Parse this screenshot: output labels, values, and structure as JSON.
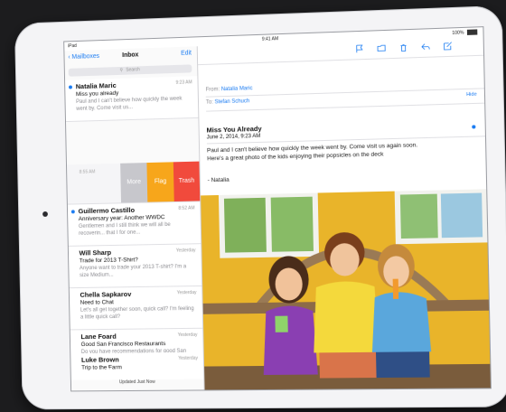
{
  "status": {
    "device": "iPad",
    "time": "9:41 AM",
    "battery": "100%"
  },
  "mailbox_nav": {
    "back_label": "Mailboxes",
    "title": "Inbox",
    "edit_label": "Edit"
  },
  "search": {
    "placeholder": "Search"
  },
  "messages": [
    {
      "sender": "Natalia Maric",
      "time": "9:23 AM",
      "subject": "Miss you already",
      "preview": "Paul and I can't believe how quickly the week went by. Come visit us...",
      "unread": true
    },
    {
      "sender": "Guillermo Castillo",
      "time": "8:52 AM",
      "subject": "Anniversary year: Another WWDC",
      "preview": "Gentlemen and I still think we will all be recoverin... that I for one...",
      "unread": true
    },
    {
      "sender": "Will Sharp",
      "time": "Yesterday",
      "subject": "Trade for 2013 T-Shirt?",
      "preview": "Anyone want to trade your 2013 T-shirt? I'm a size Medium...",
      "unread": false
    },
    {
      "sender": "Chella Sapkarov",
      "time": "Yesterday",
      "subject": "Need to Chat",
      "preview": "Let's all get together soon, quick call? I'm feeling a little quick call?",
      "unread": false
    },
    {
      "sender": "Lane Foard",
      "time": "Yesterday",
      "subject": "Good San Francisco Restaurants",
      "preview": "Do you have recommendations for good San Francisco restaurants? I...",
      "unread": false
    },
    {
      "sender": "Luke Brown",
      "time": "Yesterday",
      "subject": "Trip to the Farm",
      "preview": "",
      "unread": false
    }
  ],
  "swipe": {
    "time": "8:55 AM",
    "more_label": "More",
    "flag_label": "Flag",
    "trash_label": "Trash"
  },
  "footer": {
    "updated": "Updated Just Now"
  },
  "detail": {
    "from_label": "From:",
    "from_name": "Natalia Maric",
    "to_label": "To:",
    "to_name": "Stefan Schuch",
    "hide_label": "Hide",
    "subject": "Miss You Already",
    "date": "June 2, 2014, 9:23 AM",
    "body": "Paul and I can't believe how quickly the week went by. Come visit us again soon. Here's a great photo of the kids enjoying their popsicles on the deck",
    "signature": "- Natalia"
  },
  "toolbar_icons": [
    "flag-icon",
    "folder-icon",
    "trash-icon",
    "reply-icon",
    "compose-icon"
  ],
  "colors": {
    "accent": "#1b7cf2",
    "flag": "#f7a61b",
    "trash": "#f14a3c",
    "more": "#c7c7cc"
  }
}
